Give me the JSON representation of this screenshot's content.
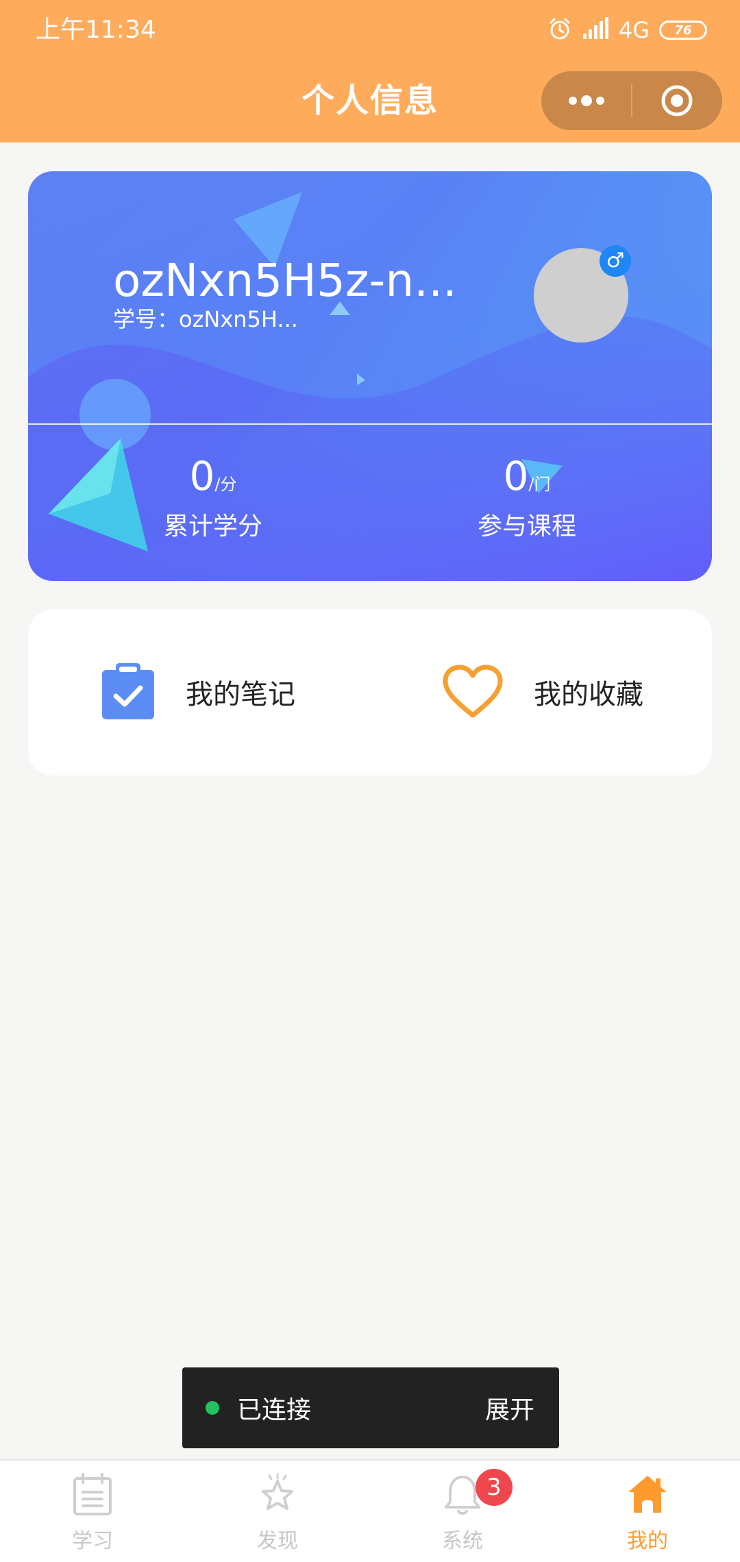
{
  "status_bar": {
    "time": "上午11:34",
    "network": "4G",
    "battery": "76"
  },
  "nav": {
    "title": "个人信息"
  },
  "profile": {
    "name": "ozNxn5H5z-n...",
    "student_id": "学号：ozNxn5H...",
    "gender_symbol": "♂",
    "stats": [
      {
        "value": "0",
        "unit": "/分",
        "label": "累计学分"
      },
      {
        "value": "0",
        "unit": "/门",
        "label": "参与课程"
      }
    ]
  },
  "links": {
    "notes_label": "我的笔记",
    "favorites_label": "我的收藏"
  },
  "toast": {
    "status": "已连接",
    "action": "展开"
  },
  "tabbar": {
    "tabs": [
      {
        "label": "学习"
      },
      {
        "label": "发现"
      },
      {
        "label": "系统",
        "badge": "3"
      },
      {
        "label": "我的"
      }
    ],
    "active_index": 3
  },
  "colors": {
    "header": "#ffab5c",
    "accent": "#ff9a2e",
    "badge": "#f0474f",
    "connected_dot": "#1fc35f"
  }
}
